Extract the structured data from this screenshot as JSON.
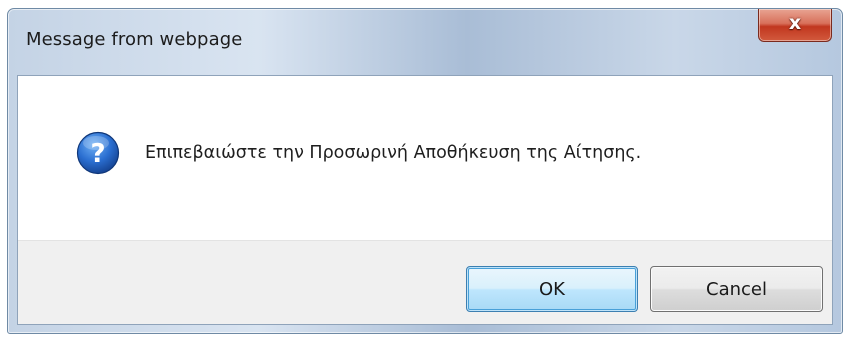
{
  "dialog": {
    "title": "Message from webpage",
    "close_glyph": "x",
    "icon": "question-icon",
    "message": "Επιπεβαιώστε την Προσωρινή Αποθήκευση της Αίτησης.",
    "buttons": {
      "ok_label": "OK",
      "cancel_label": "Cancel"
    }
  },
  "colors": {
    "close_button": "#c7442b",
    "question_icon": "#1f5fb8",
    "ok_border": "#3c7fb1",
    "footer_bg": "#f0f0f0"
  }
}
